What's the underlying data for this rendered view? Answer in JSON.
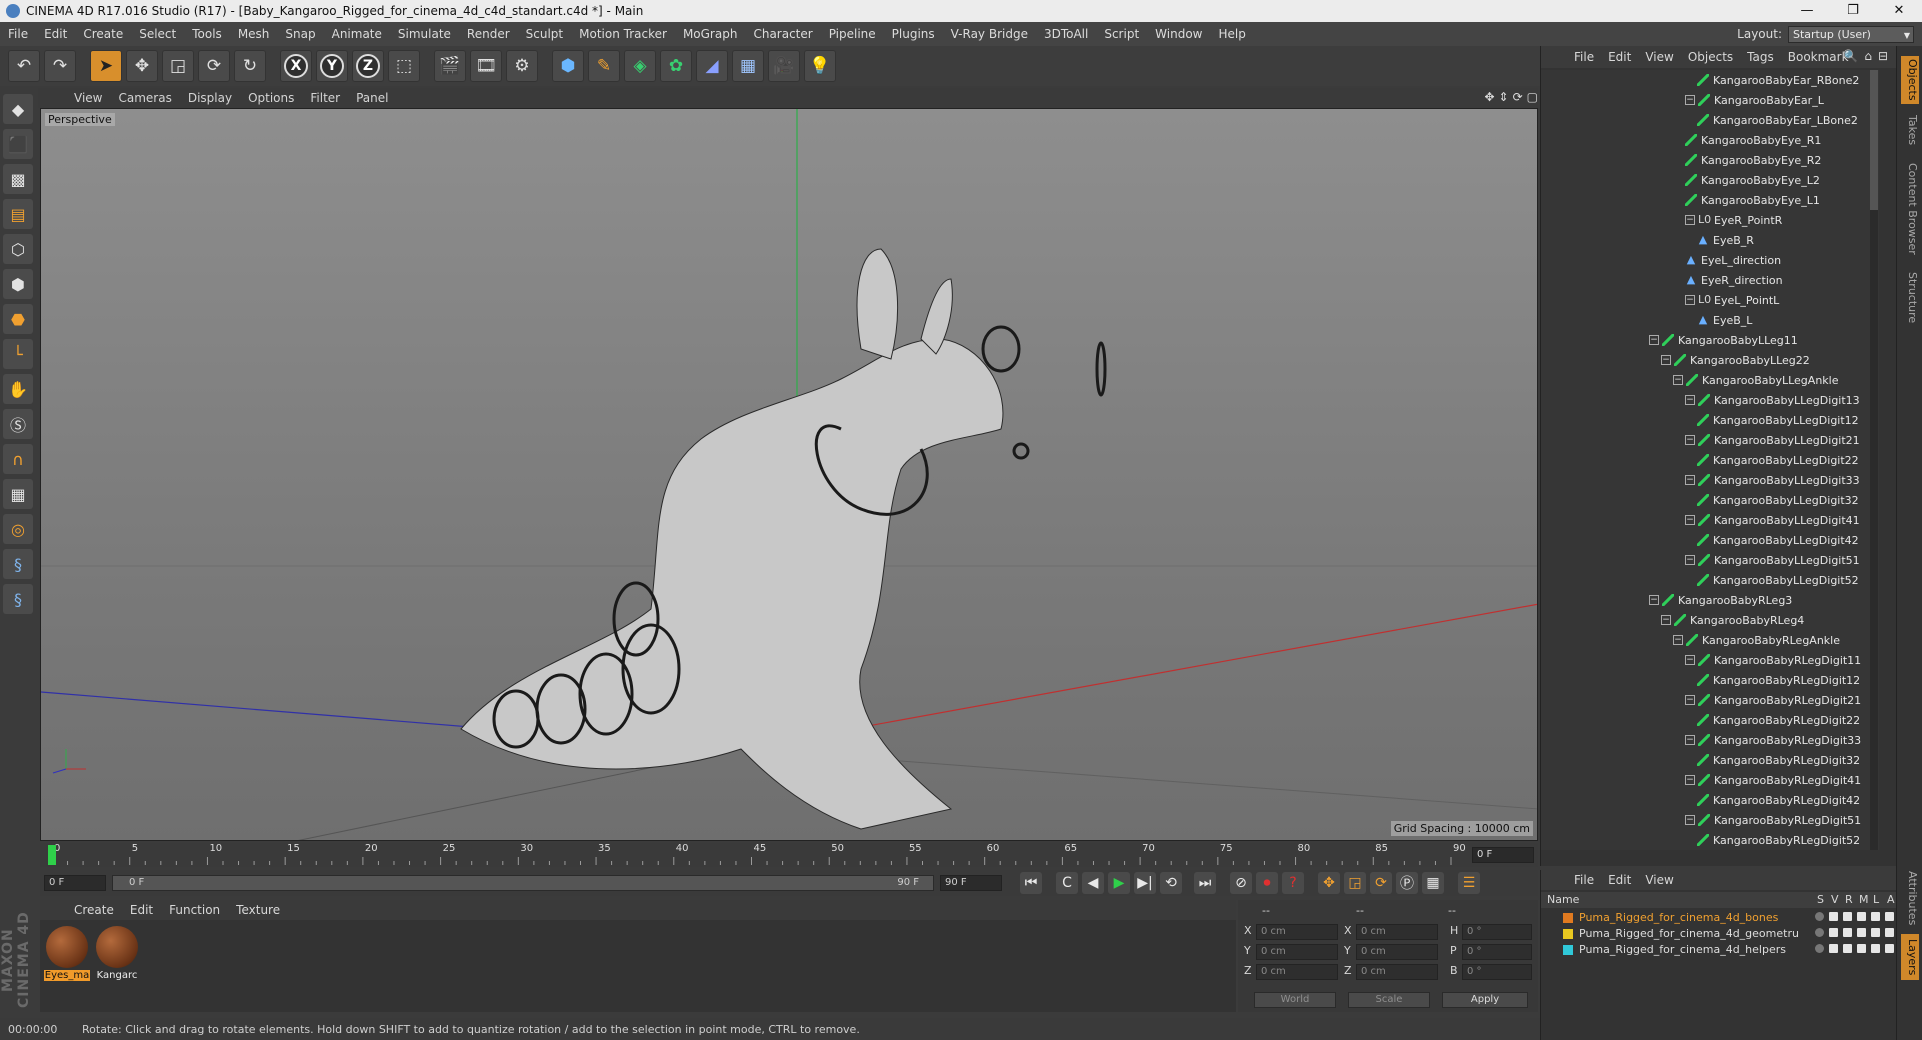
{
  "titlebar": {
    "text": "CINEMA 4D R17.016 Studio (R17) - [Baby_Kangaroo_Rigged_for_cinema_4d_c4d_standart.c4d *] - Main",
    "min": "—",
    "max": "❐",
    "close": "✕"
  },
  "menubar": [
    "File",
    "Edit",
    "Create",
    "Select",
    "Tools",
    "Mesh",
    "Snap",
    "Animate",
    "Simulate",
    "Render",
    "Sculpt",
    "Motion Tracker",
    "MoGraph",
    "Character",
    "Pipeline",
    "Plugins",
    "V-Ray Bridge",
    "3DToAll",
    "Script",
    "Window",
    "Help"
  ],
  "layout": {
    "label": "Layout:",
    "value": "Startup (User)"
  },
  "toolbar": {
    "icons": [
      "undo-icon",
      "redo-icon",
      "select-arrow-icon",
      "move-icon",
      "scale-icon",
      "rotate-icon",
      "rotate-alt-icon",
      "x-axis-icon",
      "y-axis-icon",
      "z-axis-icon",
      "coord-system-icon",
      "render-view-icon",
      "render-picture-queue-icon",
      "render-settings-icon",
      "cube-icon",
      "pen-spline-icon",
      "subdivision-icon",
      "array-icon",
      "deformer-icon",
      "floor-icon",
      "camera-icon",
      "light-icon"
    ],
    "axes": [
      "X",
      "Y",
      "Z"
    ]
  },
  "viewport": {
    "menu": [
      "View",
      "Cameras",
      "Display",
      "Options",
      "Filter",
      "Panel"
    ],
    "label": "Perspective",
    "grid_spacing": "Grid Spacing : 10000 cm"
  },
  "timeline": {
    "ticks": [
      "0",
      "5",
      "10",
      "15",
      "20",
      "25",
      "30",
      "35",
      "40",
      "45",
      "50",
      "55",
      "60",
      "65",
      "70",
      "75",
      "80",
      "85",
      "90"
    ],
    "current_frame": "0 F",
    "start": "0 F",
    "slider_start": "0 F",
    "slider_end": "90 F",
    "end": "90 F"
  },
  "materials": {
    "menu": [
      "Create",
      "Edit",
      "Function",
      "Texture"
    ],
    "items": [
      {
        "label": "Eyes_ma"
      },
      {
        "label": "Kangarc"
      }
    ]
  },
  "coords": {
    "header": [
      "--",
      "--",
      "--"
    ],
    "rows": [
      {
        "a": "X",
        "v1": "0 cm",
        "b": "X",
        "v2": "0 cm",
        "c": "H",
        "v3": "0 °"
      },
      {
        "a": "Y",
        "v1": "0 cm",
        "b": "Y",
        "v2": "0 cm",
        "c": "P",
        "v3": "0 °"
      },
      {
        "a": "Z",
        "v1": "0 cm",
        "b": "Z",
        "v2": "0 cm",
        "c": "B",
        "v3": "0 °"
      }
    ],
    "world": "World",
    "scale": "Scale",
    "apply": "Apply"
  },
  "status": {
    "time": "00:00:00",
    "message": "Rotate: Click and drag to rotate elements. Hold down SHIFT to add to quantize rotation / add to the selection in point mode, CTRL to remove."
  },
  "objects": {
    "menu": [
      "File",
      "Edit",
      "View",
      "Objects",
      "Tags",
      "Bookmark"
    ],
    "tree": [
      {
        "label": "KangarooBabyEar_RBone2",
        "level": 5,
        "icon": "bone",
        "exp": false
      },
      {
        "label": "KangarooBabyEar_L",
        "level": 4,
        "icon": "bone",
        "exp": true
      },
      {
        "label": "KangarooBabyEar_LBone2",
        "level": 5,
        "icon": "bone",
        "exp": false
      },
      {
        "label": "KangarooBabyEye_R1",
        "level": 4,
        "icon": "bone",
        "exp": false
      },
      {
        "label": "KangarooBabyEye_R2",
        "level": 4,
        "icon": "bone",
        "exp": false
      },
      {
        "label": "KangarooBabyEye_L2",
        "level": 4,
        "icon": "bone",
        "exp": false
      },
      {
        "label": "KangarooBabyEye_L1",
        "level": 4,
        "icon": "bone",
        "exp": false
      },
      {
        "label": "EyeR_PointR",
        "level": 4,
        "icon": "null",
        "exp": true
      },
      {
        "label": "EyeB_R",
        "level": 5,
        "icon": "target",
        "exp": false
      },
      {
        "label": "EyeL_direction",
        "level": 4,
        "icon": "target",
        "exp": false
      },
      {
        "label": "EyeR_direction",
        "level": 4,
        "icon": "target",
        "exp": false
      },
      {
        "label": "EyeL_PointL",
        "level": 4,
        "icon": "null",
        "exp": true
      },
      {
        "label": "EyeB_L",
        "level": 5,
        "icon": "target",
        "exp": false
      },
      {
        "label": "KangarooBabyLLeg11",
        "level": 1,
        "icon": "bone",
        "exp": true
      },
      {
        "label": "KangarooBabyLLeg22",
        "level": 2,
        "icon": "bone",
        "exp": true
      },
      {
        "label": "KangarooBabyLLegAnkle",
        "level": 3,
        "icon": "bone",
        "exp": true
      },
      {
        "label": "KangarooBabyLLegDigit13",
        "level": 4,
        "icon": "bone",
        "exp": true
      },
      {
        "label": "KangarooBabyLLegDigit12",
        "level": 5,
        "icon": "bone",
        "exp": false
      },
      {
        "label": "KangarooBabyLLegDigit21",
        "level": 4,
        "icon": "bone",
        "exp": true
      },
      {
        "label": "KangarooBabyLLegDigit22",
        "level": 5,
        "icon": "bone",
        "exp": false
      },
      {
        "label": "KangarooBabyLLegDigit33",
        "level": 4,
        "icon": "bone",
        "exp": true
      },
      {
        "label": "KangarooBabyLLegDigit32",
        "level": 5,
        "icon": "bone",
        "exp": false
      },
      {
        "label": "KangarooBabyLLegDigit41",
        "level": 4,
        "icon": "bone",
        "exp": true
      },
      {
        "label": "KangarooBabyLLegDigit42",
        "level": 5,
        "icon": "bone",
        "exp": false
      },
      {
        "label": "KangarooBabyLLegDigit51",
        "level": 4,
        "icon": "bone",
        "exp": true
      },
      {
        "label": "KangarooBabyLLegDigit52",
        "level": 5,
        "icon": "bone",
        "exp": false
      },
      {
        "label": "KangarooBabyRLeg3",
        "level": 1,
        "icon": "bone",
        "exp": true
      },
      {
        "label": "KangarooBabyRLeg4",
        "level": 2,
        "icon": "bone",
        "exp": true
      },
      {
        "label": "KangarooBabyRLegAnkle",
        "level": 3,
        "icon": "bone",
        "exp": true
      },
      {
        "label": "KangarooBabyRLegDigit11",
        "level": 4,
        "icon": "bone",
        "exp": true
      },
      {
        "label": "KangarooBabyRLegDigit12",
        "level": 5,
        "icon": "bone",
        "exp": false
      },
      {
        "label": "KangarooBabyRLegDigit21",
        "level": 4,
        "icon": "bone",
        "exp": true
      },
      {
        "label": "KangarooBabyRLegDigit22",
        "level": 5,
        "icon": "bone",
        "exp": false
      },
      {
        "label": "KangarooBabyRLegDigit33",
        "level": 4,
        "icon": "bone",
        "exp": true
      },
      {
        "label": "KangarooBabyRLegDigit32",
        "level": 5,
        "icon": "bone",
        "exp": false
      },
      {
        "label": "KangarooBabyRLegDigit41",
        "level": 4,
        "icon": "bone",
        "exp": true
      },
      {
        "label": "KangarooBabyRLegDigit42",
        "level": 5,
        "icon": "bone",
        "exp": false
      },
      {
        "label": "KangarooBabyRLegDigit51",
        "level": 4,
        "icon": "bone",
        "exp": true
      },
      {
        "label": "KangarooBabyRLegDigit52",
        "level": 5,
        "icon": "bone",
        "exp": false
      }
    ]
  },
  "layers": {
    "menu": [
      "File",
      "Edit",
      "View"
    ],
    "header": {
      "name": "Name",
      "cols": [
        "S",
        "V",
        "R",
        "M",
        "L",
        "A"
      ]
    },
    "items": [
      {
        "label": "Puma_Rigged_for_cinema_4d_bones",
        "color": "#e07a20",
        "selected": true
      },
      {
        "label": "Puma_Rigged_for_cinema_4d_geometru",
        "color": "#e8c820",
        "selected": false
      },
      {
        "label": "Puma_Rigged_for_cinema_4d_helpers",
        "color": "#30c8d8",
        "selected": false
      }
    ]
  },
  "side_tabs": [
    "Objects",
    "Takes",
    "Content Browser",
    "Structure",
    "Attributes",
    "Layers"
  ],
  "maxon": "MAXON CINEMA 4D"
}
